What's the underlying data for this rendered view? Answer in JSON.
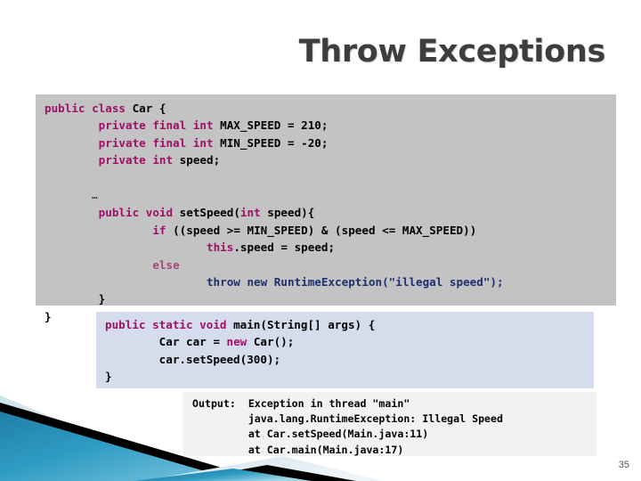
{
  "slide": {
    "title": "Throw Exceptions",
    "page_number": "35",
    "accent_colors": {
      "title_text": "#3d3d3d",
      "keyword": "#9e1068",
      "throw_line": "#1c2f6e",
      "class_block_bg": "#c3c3c3",
      "main_block_bg": "#d5dded",
      "output_block_bg": "#f2f2f2",
      "deco_blue": "#2b95bd",
      "deco_black": "#000000"
    }
  },
  "code_class": {
    "lines": [
      [
        {
          "t": "public class ",
          "c": "kw"
        },
        {
          "t": "Car {",
          "c": "plain"
        }
      ],
      [
        {
          "t": "        private final int ",
          "c": "kw"
        },
        {
          "t": "MAX_SPEED = 210;",
          "c": "plain"
        }
      ],
      [
        {
          "t": "        private final int ",
          "c": "kw"
        },
        {
          "t": "MIN_SPEED = -20;",
          "c": "plain"
        }
      ],
      [
        {
          "t": "        private int ",
          "c": "kw"
        },
        {
          "t": "speed;",
          "c": "plain"
        }
      ],
      [
        {
          "t": "",
          "c": "plain"
        }
      ],
      [
        {
          "t": "        …",
          "c": "dots"
        }
      ],
      [
        {
          "t": "        public void ",
          "c": "kw"
        },
        {
          "t": "setSpeed(",
          "c": "plain"
        },
        {
          "t": "int ",
          "c": "kw"
        },
        {
          "t": "speed){",
          "c": "plain"
        }
      ],
      [
        {
          "t": "                ",
          "c": "plain"
        },
        {
          "t": "if ",
          "c": "kw"
        },
        {
          "t": "((speed >= MIN_SPEED) & (speed <= MAX_SPEED))",
          "c": "plain"
        }
      ],
      [
        {
          "t": "                        ",
          "c": "plain"
        },
        {
          "t": "this",
          "c": "kw"
        },
        {
          "t": ".speed = speed;",
          "c": "plain"
        }
      ],
      [
        {
          "t": "                ",
          "c": "plain"
        },
        {
          "t": "else",
          "c": "kw2"
        }
      ],
      [
        {
          "t": "                        throw new RuntimeException(\"illegal speed\");",
          "c": "throwln"
        }
      ],
      [
        {
          "t": "        }",
          "c": "plain"
        }
      ],
      [
        {
          "t": "}",
          "c": "plain"
        }
      ]
    ]
  },
  "code_main": {
    "lines": [
      [
        {
          "t": "public static void ",
          "c": "kw"
        },
        {
          "t": "main(String[] args) {",
          "c": "plain"
        }
      ],
      [
        {
          "t": "        Car car = ",
          "c": "plain"
        },
        {
          "t": "new ",
          "c": "kw"
        },
        {
          "t": "Car();",
          "c": "plain"
        }
      ],
      [
        {
          "t": "        car.setSpeed(300);",
          "c": "plain"
        }
      ],
      [
        {
          "t": "}",
          "c": "plain"
        }
      ]
    ]
  },
  "code_output": {
    "lines": [
      [
        {
          "t": "Output:  Exception in thread \"main\"",
          "c": "plain"
        }
      ],
      [
        {
          "t": "         java.lang.RuntimeException: Illegal Speed",
          "c": "plain"
        }
      ],
      [
        {
          "t": "         at Car.setSpeed(Main.java:11)",
          "c": "plain"
        }
      ],
      [
        {
          "t": "         at Car.main(Main.java:17)",
          "c": "plain"
        }
      ]
    ]
  }
}
